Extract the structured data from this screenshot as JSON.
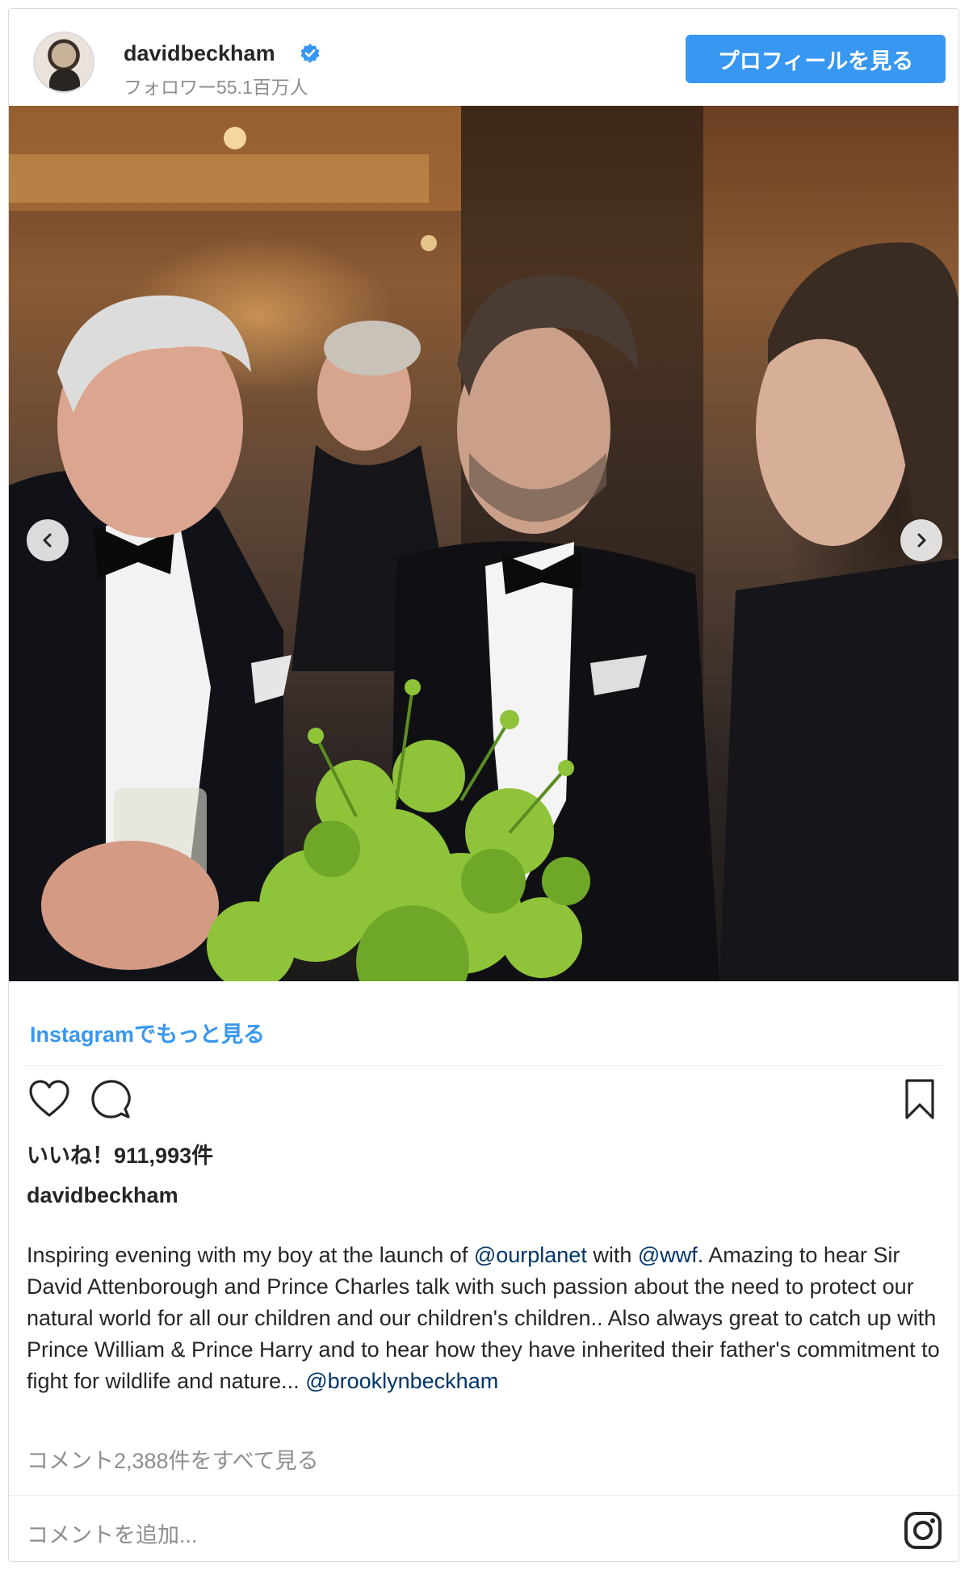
{
  "header": {
    "username": "davidbeckham",
    "followers": "フォロワー55.1百万人",
    "profile_button": "プロフィールを見る"
  },
  "post": {
    "more_link": "Instagramでもっと見る",
    "likes": "いいね！911,993件",
    "caption_user": "davidbeckham",
    "caption": {
      "t1": "Inspiring evening with my boy at the launch of ",
      "m1": "@ourplanet",
      "t2": " with ",
      "m2": "@wwf",
      "t3": ". Amazing to hear Sir David Attenborough and Prince Charles talk with such passion about the need to protect our natural world for all our children and our children's children.. Also always great to catch up with Prince William & Prince Harry and to hear how they have inherited their father's commitment to fight for wildlife and nature... ",
      "m3": "@brooklynbeckham"
    },
    "view_comments": "コメント2,388件をすべて見る",
    "add_comment_placeholder": "コメントを追加..."
  },
  "icons": {
    "verified": "verified-badge-icon",
    "prev": "chevron-left-icon",
    "next": "chevron-right-icon",
    "like": "heart-icon",
    "comment": "comment-bubble-icon",
    "save": "bookmark-icon",
    "instagram": "instagram-logo-icon"
  },
  "colors": {
    "accent": "#3897f0",
    "mention": "#003569",
    "muted": "#8e8e8e",
    "text": "#262626"
  }
}
